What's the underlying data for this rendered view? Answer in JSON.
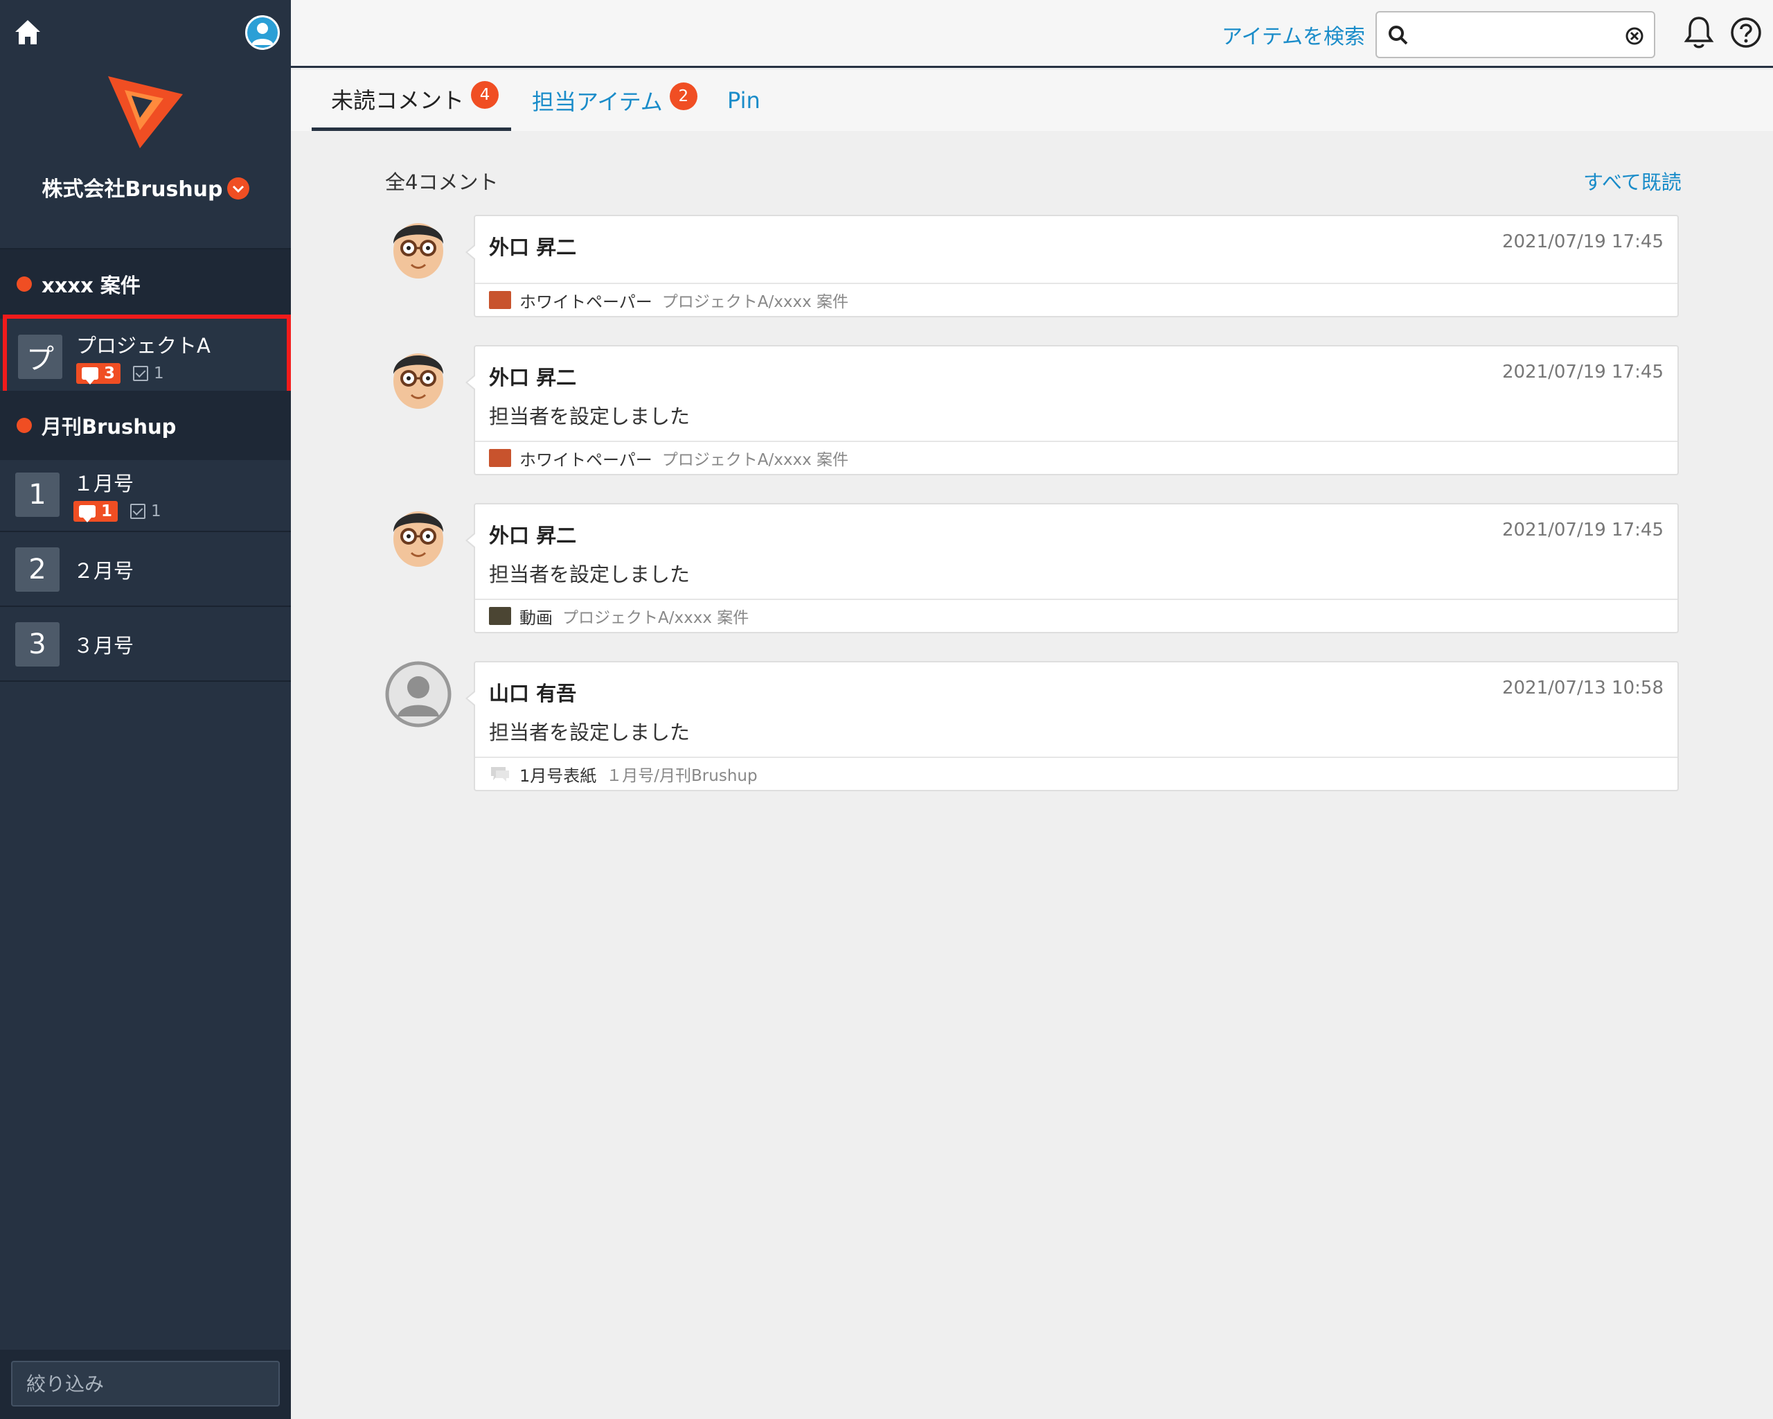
{
  "sidebar": {
    "org_name": "株式会社Brushup",
    "groups": [
      {
        "label": "xxxx 案件",
        "items": [
          {
            "initial": "プ",
            "title": "プロジェクトA",
            "comments": "3",
            "tasks": "1"
          }
        ]
      },
      {
        "label": "月刊Brushup",
        "items": [
          {
            "initial": "1",
            "title": "１月号",
            "comments": "1",
            "tasks": "1"
          },
          {
            "initial": "2",
            "title": "２月号"
          },
          {
            "initial": "3",
            "title": "３月号"
          }
        ]
      }
    ],
    "filter_placeholder": "絞り込み"
  },
  "topbar": {
    "search_label": "アイテムを検索",
    "search_value": ""
  },
  "tabs": [
    {
      "label": "未読コメント",
      "count": "4"
    },
    {
      "label": "担当アイテム",
      "count": "2"
    },
    {
      "label": "Pin"
    }
  ],
  "main": {
    "total_label": "全4コメント",
    "mark_all_read": "すべて既読",
    "comments": [
      {
        "author": "外口 昇二",
        "date": "2021/07/19 17:45",
        "body": "",
        "item": "ホワイトペーパー",
        "path": "プロジェクトA/xxxx 案件",
        "avatar": "glasses-avatar-icon",
        "thumb": "document-thumbnail"
      },
      {
        "author": "外口 昇二",
        "date": "2021/07/19 17:45",
        "body": "担当者を設定しました",
        "item": "ホワイトペーパー",
        "path": "プロジェクトA/xxxx 案件",
        "avatar": "glasses-avatar-icon",
        "thumb": "document-thumbnail"
      },
      {
        "author": "外口 昇二",
        "date": "2021/07/19 17:45",
        "body": "担当者を設定しました",
        "item": "動画",
        "path": "プロジェクトA/xxxx 案件",
        "avatar": "glasses-avatar-icon",
        "thumb": "video-thumbnail"
      },
      {
        "author": "山口 有吾",
        "date": "2021/07/13 10:58",
        "body": "担当者を設定しました",
        "item": "1月号表紙",
        "path": "１月号/月刊Brushup",
        "avatar": "default-user-avatar-icon",
        "thumb": "comment-thumbnail"
      }
    ]
  },
  "colors": {
    "sidebar_bg": "#263242",
    "accent_orange": "#f04e23",
    "link_blue": "#1a8cc9",
    "selection_red": "#f21b1b"
  }
}
